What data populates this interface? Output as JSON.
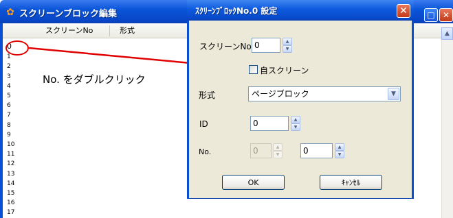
{
  "background_window": {
    "title": "スクリーンブロック編集",
    "columns": [
      "スクリーンNo",
      "形式"
    ],
    "row_numbers": [
      "0",
      "1",
      "2",
      "3",
      "4",
      "5",
      "6",
      "7",
      "8",
      "9",
      "10",
      "11",
      "12",
      "13",
      "14",
      "15",
      "16",
      "17"
    ],
    "maximize_icon": "maximize-icon",
    "close_icon": "close-icon"
  },
  "annotation": {
    "text": "No. をダブルクリック",
    "color": "#e00000"
  },
  "dialog": {
    "title": "ｽｸﾘｰﾝﾌﾞﾛｯｸNo.0 設定",
    "screen_no_label": "スクリーンNo",
    "screen_no_value": "0",
    "self_screen_label": "自スクリーン",
    "self_screen_checked": false,
    "type_label": "形式",
    "type_value": "ページブロック",
    "id_label": "ID",
    "id_value": "0",
    "no_label": "No.",
    "no_value_1": "0",
    "no_value_2": "0",
    "ok_label": "OK",
    "cancel_label": "ｷｬﾝｾﾙ"
  },
  "colors": {
    "titlebar": "#0a55d8",
    "dialog_bg": "#ece9d8",
    "close_button": "#c33a18"
  }
}
